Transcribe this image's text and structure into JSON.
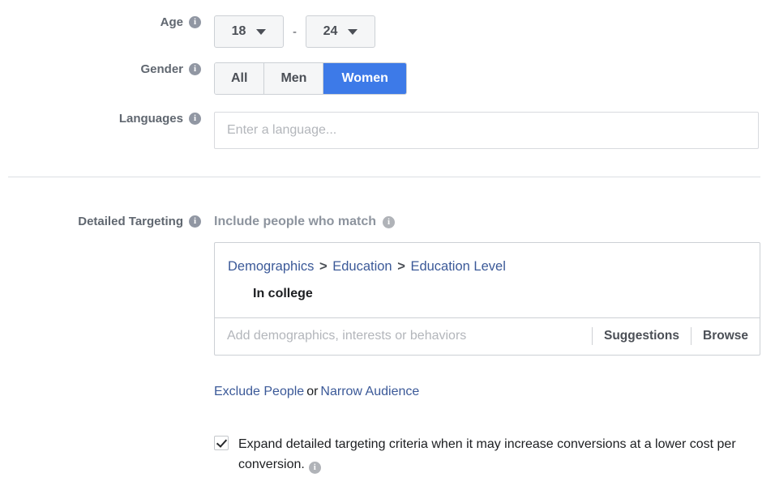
{
  "age": {
    "label": "Age",
    "info_icon": "info-icon",
    "min_value": "18",
    "max_value": "24",
    "separator": "-",
    "caret_icon": "chevron-down-icon"
  },
  "gender": {
    "label": "Gender",
    "info_icon": "info-icon",
    "options": [
      {
        "label": "All",
        "selected": false
      },
      {
        "label": "Men",
        "selected": false
      },
      {
        "label": "Women",
        "selected": true
      }
    ],
    "selected": "Women",
    "active_color": "#3d7ae8"
  },
  "languages": {
    "label": "Languages",
    "info_icon": "info-icon",
    "value": "",
    "placeholder": "Enter a language..."
  },
  "detailed_targeting": {
    "label": "Detailed Targeting",
    "info_icon": "info-icon",
    "include_heading": "Include people who match",
    "include_info_icon": "info-icon",
    "breadcrumb": {
      "items": [
        "Demographics",
        "Education",
        "Education Level"
      ],
      "separator": ">",
      "link_color": "#3b5998"
    },
    "selected_item": "In college",
    "search": {
      "value": "",
      "placeholder": "Add demographics, interests or behaviors",
      "suggestions_label": "Suggestions",
      "browse_label": "Browse"
    },
    "links": {
      "exclude": "Exclude People",
      "conjunction": "or",
      "narrow": "Narrow Audience"
    },
    "expand_option": {
      "checked": true,
      "text": "Expand detailed targeting criteria when it may increase conversions at a lower cost per conversion.",
      "info_icon": "info-icon"
    }
  }
}
